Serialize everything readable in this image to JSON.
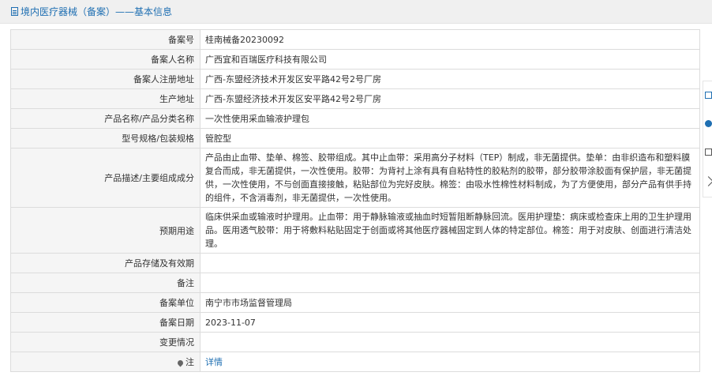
{
  "header": {
    "title": "境内医疗器械（备案）——基本信息"
  },
  "rows": [
    {
      "label": "备案号",
      "value": "桂南械备20230092"
    },
    {
      "label": "备案人名称",
      "value": "广西宜和百瑞医疗科技有限公司"
    },
    {
      "label": "备案人注册地址",
      "value": "广西-东盟经济技术开发区安平路42号2号厂房"
    },
    {
      "label": "生产地址",
      "value": "广西-东盟经济技术开发区安平路42号2号厂房"
    },
    {
      "label": "产品名称/产品分类名称",
      "value": "一次性使用采血输液护理包"
    },
    {
      "label": "型号规格/包装规格",
      "value": "管腔型"
    },
    {
      "label": "产品描述/主要组成成分",
      "value": "产品由止血带、垫单、棉签、胶带组成。其中止血带：采用高分子材料（TEP）制成，非无菌提供。垫单：由非织造布和塑料膜复合而成，非无菌提供，一次性使用。胶带：为背衬上涂有具有自粘特性的胶粘剂的胶带，部分胶带涂胶面有保护层，非无菌提供，一次性使用，不与创面直接接触，粘贴部位为完好皮肤。棉签：由吸水性棉性材料制成，为了方便使用，部分产品有供手持的组件，不含消毒剂，非无菌提供，一次性使用。"
    },
    {
      "label": "预期用途",
      "value": "临床供采血或输液时护理用。止血带：用于静脉输液或抽血时短暂阻断静脉回流。医用护理垫：病床或检查床上用的卫生护理用品。医用透气胶带：用于将敷料粘贴固定于创面或将其他医疗器械固定到人体的特定部位。棉签：用于对皮肤、创面进行清洁处理。"
    },
    {
      "label": "产品存储及有效期",
      "value": ""
    },
    {
      "label": "备注",
      "value": ""
    },
    {
      "label": "备案单位",
      "value": "南宁市市场监督管理局"
    },
    {
      "label": "备案日期",
      "value": "2023-11-07"
    },
    {
      "label": "变更情况",
      "value": ""
    },
    {
      "label": "注",
      "value": "详情"
    }
  ]
}
